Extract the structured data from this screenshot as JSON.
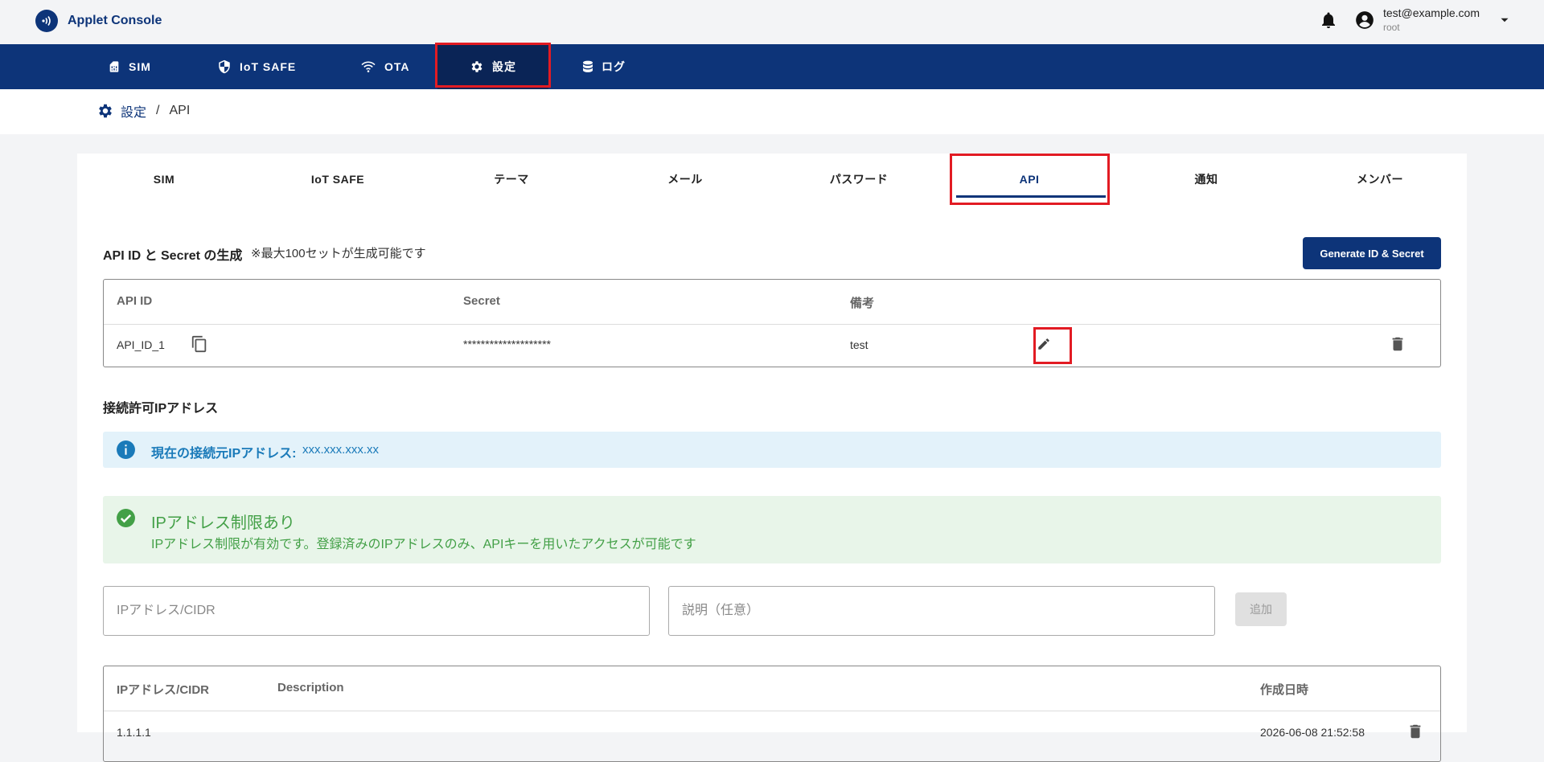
{
  "app": {
    "title": "Applet Console",
    "user_email": "test@example.com",
    "user_role": "root"
  },
  "nav": {
    "items": [
      {
        "label": "SIM",
        "icon": "sim-card-icon"
      },
      {
        "label": "IoT SAFE",
        "icon": "shield-icon"
      },
      {
        "label": "OTA",
        "icon": "wifi-icon"
      },
      {
        "label": "設定",
        "icon": "gear-icon"
      },
      {
        "label": "ログ",
        "icon": "database-icon"
      }
    ],
    "active": "設定"
  },
  "breadcrumb": {
    "parent": "設定",
    "separator": "/",
    "current": "API"
  },
  "tabs": {
    "items": [
      "SIM",
      "IoT SAFE",
      "テーマ",
      "メール",
      "パスワード",
      "API",
      "通知",
      "メンバー"
    ],
    "active": "API"
  },
  "api_section": {
    "title": "API ID と Secret の生成",
    "note": "※最大100セットが生成可能です",
    "generate_label": "Generate ID & Secret",
    "columns": [
      "API ID",
      "Secret",
      "備考"
    ],
    "rows": [
      {
        "api_id": "API_ID_1",
        "secret": "********************",
        "note": "test"
      }
    ]
  },
  "ip_section": {
    "title": "接続許可IPアドレス",
    "current_label": "現在の接続元IPアドレス:",
    "current_value": "xxx.xxx.xxx.xx",
    "status_title": "IPアドレス制限あり",
    "status_text": "IPアドレス制限が有効です。登録済みのIPアドレスのみ、APIキーを用いたアクセスが可能です",
    "ip_placeholder": "IPアドレス/CIDR",
    "desc_placeholder": "説明（任意）",
    "add_label": "追加",
    "columns": [
      "IPアドレス/CIDR",
      "Description",
      "作成日時"
    ],
    "rows": [
      {
        "ip": "1.1.1.1",
        "description": "",
        "created": "2026-06-08 21:52:58"
      }
    ]
  },
  "colors": {
    "primary": "#0d3479",
    "highlight": "#e21b23",
    "info_bg": "#e3f2fa",
    "info_text": "#1a7ab9",
    "success_bg": "#e8f5e9",
    "success_text": "#43a047"
  }
}
